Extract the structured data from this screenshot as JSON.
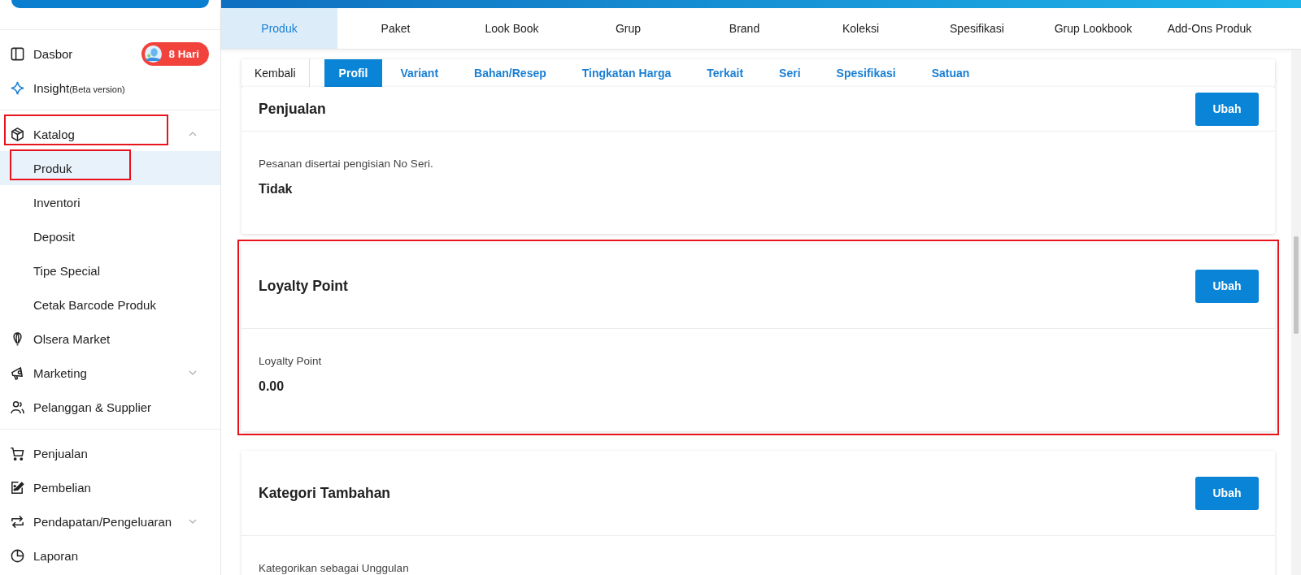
{
  "sidebar": {
    "sections": [
      {
        "items": [
          {
            "label": "Dasbor",
            "selected": false,
            "badge": "8 Hari"
          },
          {
            "label": "Insight",
            "note": "(Beta version)",
            "selected": false
          }
        ]
      },
      {
        "items": [
          {
            "label": "Katalog",
            "selected": false,
            "expanded": true,
            "highlighted": true,
            "children": [
              {
                "label": "Produk",
                "selected": true,
                "highlighted": true
              },
              {
                "label": "Inventori",
                "selected": false,
                "highlighted": false
              },
              {
                "label": "Deposit",
                "selected": false,
                "highlighted": false
              },
              {
                "label": "Tipe Special",
                "selected": false,
                "highlighted": false
              },
              {
                "label": "Cetak Barcode Produk",
                "selected": false,
                "highlighted": false
              }
            ]
          },
          {
            "label": "Olsera Market",
            "selected": false
          },
          {
            "label": "Marketing",
            "selected": false,
            "expanded": false
          },
          {
            "label": "Pelanggan & Supplier",
            "selected": false
          }
        ]
      },
      {
        "items": [
          {
            "label": "Penjualan",
            "selected": false
          },
          {
            "label": "Pembelian",
            "selected": false
          },
          {
            "label": "Pendapatan/Pengeluaran",
            "selected": false,
            "expanded": false
          },
          {
            "label": "Laporan",
            "selected": false
          }
        ]
      }
    ]
  },
  "tabs": [
    {
      "label": "Produk",
      "selected": true
    },
    {
      "label": "Paket",
      "selected": false
    },
    {
      "label": "Look Book",
      "selected": false
    },
    {
      "label": "Grup",
      "selected": false
    },
    {
      "label": "Brand",
      "selected": false
    },
    {
      "label": "Koleksi",
      "selected": false
    },
    {
      "label": "Spesifikasi",
      "selected": false
    },
    {
      "label": "Grup Lookbook",
      "selected": false
    },
    {
      "label": "Add-Ons Produk",
      "selected": false
    }
  ],
  "subtabs": [
    {
      "label": "Kembali",
      "kind": "back"
    },
    {
      "label": "Profil",
      "kind": "tab",
      "selected": true
    },
    {
      "label": "Variant",
      "kind": "tab",
      "selected": false
    },
    {
      "label": "Bahan/Resep",
      "kind": "tab",
      "selected": false
    },
    {
      "label": "Tingkatan Harga",
      "kind": "tab",
      "selected": false
    },
    {
      "label": "Terkait",
      "kind": "tab",
      "selected": false
    },
    {
      "label": "Seri",
      "kind": "tab",
      "selected": false
    },
    {
      "label": "Spesifikasi",
      "kind": "tab",
      "selected": false
    },
    {
      "label": "Satuan",
      "kind": "tab",
      "selected": false
    }
  ],
  "sections": [
    {
      "title": "Penjualan",
      "button": "Ubah",
      "highlighted": false,
      "fields": [
        {
          "label": "Pesanan disertai pengisian No Seri.",
          "value": "Tidak"
        }
      ]
    },
    {
      "title": "Loyalty Point",
      "button": "Ubah",
      "highlighted": true,
      "fields": [
        {
          "label": "Loyalty Point",
          "value": "0.00"
        }
      ]
    },
    {
      "title": "Kategori Tambahan",
      "button": "Ubah",
      "highlighted": false,
      "fields": [
        {
          "label": "Kategorikan sebagai Unggulan"
        }
      ]
    }
  ]
}
